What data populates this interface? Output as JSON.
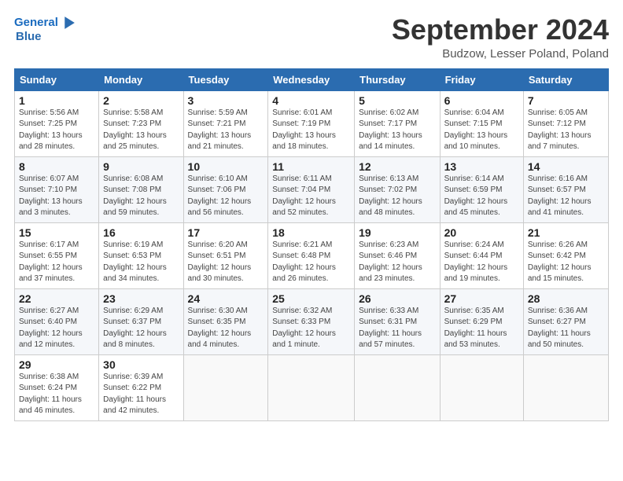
{
  "header": {
    "logo_line1": "General",
    "logo_line2": "Blue",
    "title": "September 2024",
    "location": "Budzow, Lesser Poland, Poland"
  },
  "weekdays": [
    "Sunday",
    "Monday",
    "Tuesday",
    "Wednesday",
    "Thursday",
    "Friday",
    "Saturday"
  ],
  "weeks": [
    [
      {
        "day": "1",
        "info": "Sunrise: 5:56 AM\nSunset: 7:25 PM\nDaylight: 13 hours\nand 28 minutes."
      },
      {
        "day": "2",
        "info": "Sunrise: 5:58 AM\nSunset: 7:23 PM\nDaylight: 13 hours\nand 25 minutes."
      },
      {
        "day": "3",
        "info": "Sunrise: 5:59 AM\nSunset: 7:21 PM\nDaylight: 13 hours\nand 21 minutes."
      },
      {
        "day": "4",
        "info": "Sunrise: 6:01 AM\nSunset: 7:19 PM\nDaylight: 13 hours\nand 18 minutes."
      },
      {
        "day": "5",
        "info": "Sunrise: 6:02 AM\nSunset: 7:17 PM\nDaylight: 13 hours\nand 14 minutes."
      },
      {
        "day": "6",
        "info": "Sunrise: 6:04 AM\nSunset: 7:15 PM\nDaylight: 13 hours\nand 10 minutes."
      },
      {
        "day": "7",
        "info": "Sunrise: 6:05 AM\nSunset: 7:12 PM\nDaylight: 13 hours\nand 7 minutes."
      }
    ],
    [
      {
        "day": "8",
        "info": "Sunrise: 6:07 AM\nSunset: 7:10 PM\nDaylight: 13 hours\nand 3 minutes."
      },
      {
        "day": "9",
        "info": "Sunrise: 6:08 AM\nSunset: 7:08 PM\nDaylight: 12 hours\nand 59 minutes."
      },
      {
        "day": "10",
        "info": "Sunrise: 6:10 AM\nSunset: 7:06 PM\nDaylight: 12 hours\nand 56 minutes."
      },
      {
        "day": "11",
        "info": "Sunrise: 6:11 AM\nSunset: 7:04 PM\nDaylight: 12 hours\nand 52 minutes."
      },
      {
        "day": "12",
        "info": "Sunrise: 6:13 AM\nSunset: 7:02 PM\nDaylight: 12 hours\nand 48 minutes."
      },
      {
        "day": "13",
        "info": "Sunrise: 6:14 AM\nSunset: 6:59 PM\nDaylight: 12 hours\nand 45 minutes."
      },
      {
        "day": "14",
        "info": "Sunrise: 6:16 AM\nSunset: 6:57 PM\nDaylight: 12 hours\nand 41 minutes."
      }
    ],
    [
      {
        "day": "15",
        "info": "Sunrise: 6:17 AM\nSunset: 6:55 PM\nDaylight: 12 hours\nand 37 minutes."
      },
      {
        "day": "16",
        "info": "Sunrise: 6:19 AM\nSunset: 6:53 PM\nDaylight: 12 hours\nand 34 minutes."
      },
      {
        "day": "17",
        "info": "Sunrise: 6:20 AM\nSunset: 6:51 PM\nDaylight: 12 hours\nand 30 minutes."
      },
      {
        "day": "18",
        "info": "Sunrise: 6:21 AM\nSunset: 6:48 PM\nDaylight: 12 hours\nand 26 minutes."
      },
      {
        "day": "19",
        "info": "Sunrise: 6:23 AM\nSunset: 6:46 PM\nDaylight: 12 hours\nand 23 minutes."
      },
      {
        "day": "20",
        "info": "Sunrise: 6:24 AM\nSunset: 6:44 PM\nDaylight: 12 hours\nand 19 minutes."
      },
      {
        "day": "21",
        "info": "Sunrise: 6:26 AM\nSunset: 6:42 PM\nDaylight: 12 hours\nand 15 minutes."
      }
    ],
    [
      {
        "day": "22",
        "info": "Sunrise: 6:27 AM\nSunset: 6:40 PM\nDaylight: 12 hours\nand 12 minutes."
      },
      {
        "day": "23",
        "info": "Sunrise: 6:29 AM\nSunset: 6:37 PM\nDaylight: 12 hours\nand 8 minutes."
      },
      {
        "day": "24",
        "info": "Sunrise: 6:30 AM\nSunset: 6:35 PM\nDaylight: 12 hours\nand 4 minutes."
      },
      {
        "day": "25",
        "info": "Sunrise: 6:32 AM\nSunset: 6:33 PM\nDaylight: 12 hours\nand 1 minute."
      },
      {
        "day": "26",
        "info": "Sunrise: 6:33 AM\nSunset: 6:31 PM\nDaylight: 11 hours\nand 57 minutes."
      },
      {
        "day": "27",
        "info": "Sunrise: 6:35 AM\nSunset: 6:29 PM\nDaylight: 11 hours\nand 53 minutes."
      },
      {
        "day": "28",
        "info": "Sunrise: 6:36 AM\nSunset: 6:27 PM\nDaylight: 11 hours\nand 50 minutes."
      }
    ],
    [
      {
        "day": "29",
        "info": "Sunrise: 6:38 AM\nSunset: 6:24 PM\nDaylight: 11 hours\nand 46 minutes."
      },
      {
        "day": "30",
        "info": "Sunrise: 6:39 AM\nSunset: 6:22 PM\nDaylight: 11 hours\nand 42 minutes."
      },
      {
        "day": "",
        "info": ""
      },
      {
        "day": "",
        "info": ""
      },
      {
        "day": "",
        "info": ""
      },
      {
        "day": "",
        "info": ""
      },
      {
        "day": "",
        "info": ""
      }
    ]
  ]
}
